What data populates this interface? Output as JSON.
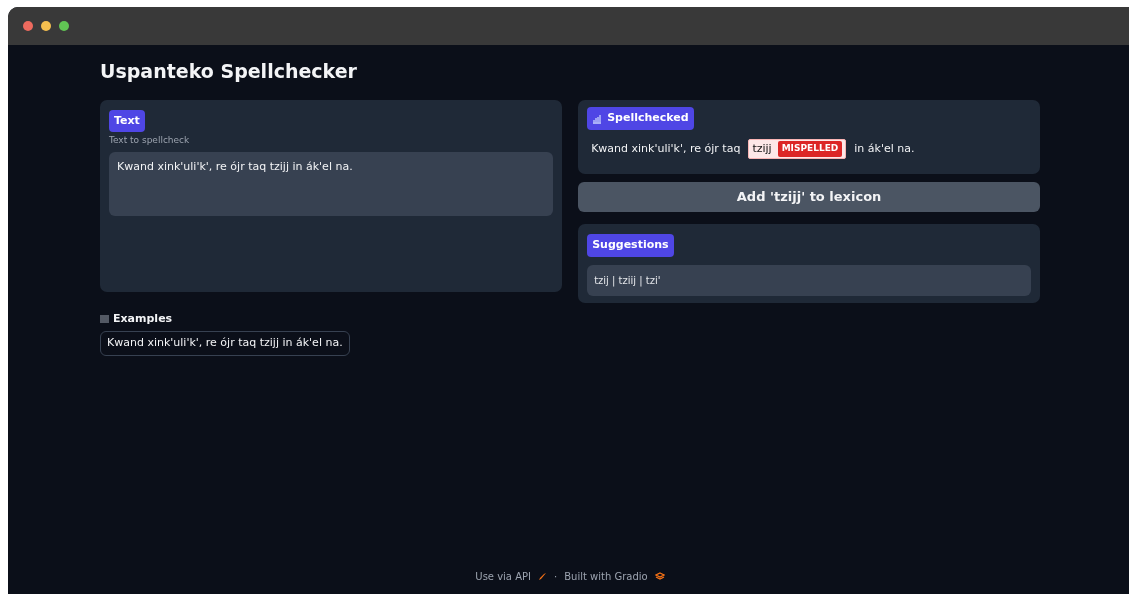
{
  "window": {
    "controls": [
      {
        "color": "#ed6a5e"
      },
      {
        "color": "#f5bf4f"
      },
      {
        "color": "#61c554"
      }
    ]
  },
  "title": "Uspanteko Spellchecker",
  "input": {
    "label": "Text",
    "info": "Text to spellcheck",
    "value": "Kwand xink'uli'k', re ójr taq tzijj in ák'el na."
  },
  "output": {
    "label": "Spellchecked",
    "segments": [
      {
        "kind": "text",
        "text": "Kwand xink'uli'k', re ójr taq"
      },
      {
        "kind": "error",
        "text": "tzijj",
        "tag": "MISPELLED"
      },
      {
        "kind": "text",
        "text": "in ák'el na."
      }
    ]
  },
  "add_button": "Add 'tzijj' to lexicon",
  "suggestions": {
    "label": "Suggestions",
    "value": "tzij | tziij | tzi'"
  },
  "examples": {
    "label": "Examples",
    "items": [
      "Kwand xink'uli'k', re ójr taq tzijj in ák'el na."
    ]
  },
  "footer": {
    "api": "Use via API",
    "separator": "·",
    "built": "Built with Gradio"
  }
}
